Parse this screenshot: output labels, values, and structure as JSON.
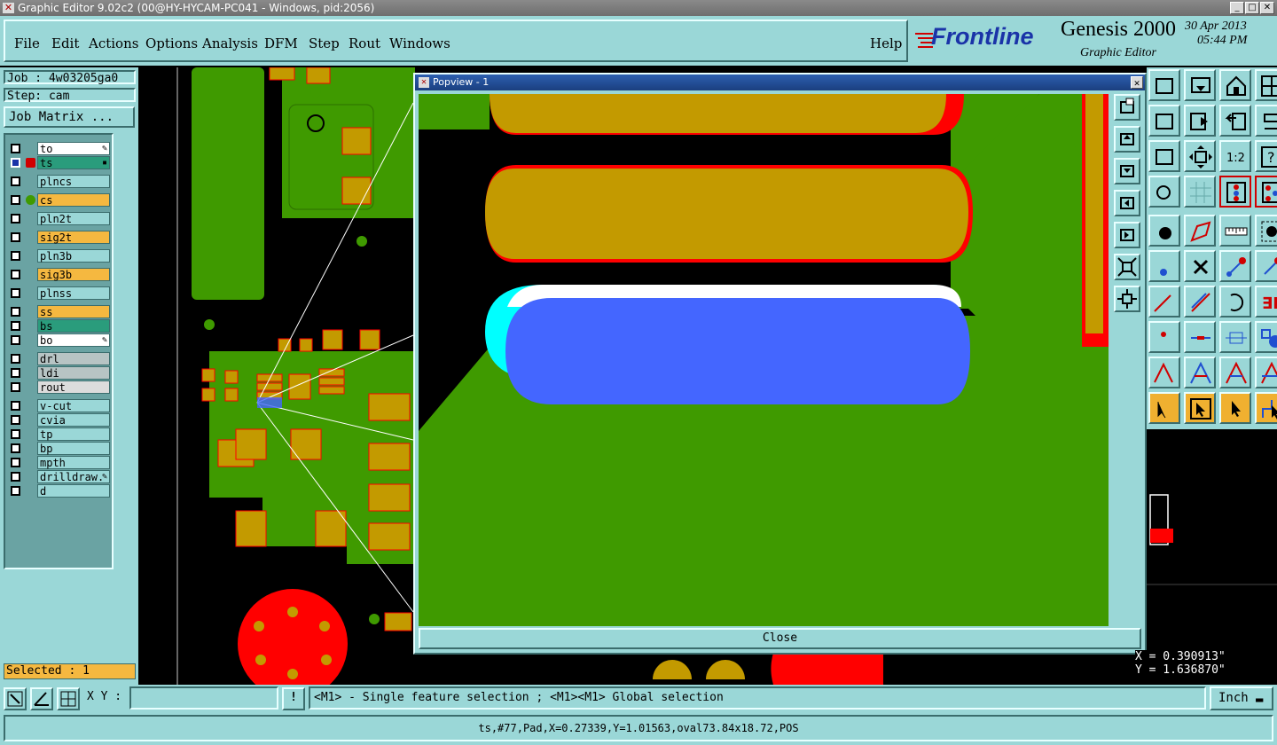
{
  "window": {
    "title": "Graphic Editor 9.02c2 (00@HY-HYCAM-PC041 - Windows, pid:2056)",
    "controls": [
      "_",
      "□",
      "✕"
    ]
  },
  "menu": {
    "items": [
      "File",
      "Edit",
      "Actions",
      "Options",
      "Analysis",
      "DFM",
      "Step",
      "Rout",
      "Windows"
    ],
    "help": "Help"
  },
  "logo": {
    "brand": "Frontline",
    "product": "Genesis 2000",
    "subtitle": "Graphic Editor",
    "date": "30 Apr 2013",
    "time": "05:44 PM"
  },
  "job": {
    "job_label": "Job : 4w03205ga0",
    "step_label": "Step: cam",
    "matrix_button": "Job Matrix ..."
  },
  "layers": [
    {
      "name": "to",
      "bg": "#ffffff",
      "mark": "pen"
    },
    {
      "name": "ts",
      "bg": "#2a9c7c",
      "mark": "active"
    },
    {
      "name": "plncs",
      "bg": "#9ad7d7"
    },
    {
      "name": "cs",
      "bg": "#f5b840",
      "mark": "green-dot"
    },
    {
      "name": "pln2t",
      "bg": "#9ad7d7"
    },
    {
      "name": "sig2t",
      "bg": "#f5b840"
    },
    {
      "name": "pln3b",
      "bg": "#9ad7d7"
    },
    {
      "name": "sig3b",
      "bg": "#f5b840"
    },
    {
      "name": "plnss",
      "bg": "#9ad7d7"
    },
    {
      "name": "ss",
      "bg": "#f5b840"
    },
    {
      "name": "bs",
      "bg": "#2a9c7c"
    },
    {
      "name": "bo",
      "bg": "#ffffff",
      "mark": "pen"
    },
    {
      "name": "drl",
      "bg": "#b7c4c4"
    },
    {
      "name": "ldi",
      "bg": "#b7c4c4"
    },
    {
      "name": "rout",
      "bg": "#dcdcdc"
    },
    {
      "name": "v-cut",
      "bg": "#9ad7d7"
    },
    {
      "name": "cvia",
      "bg": "#9ad7d7"
    },
    {
      "name": "tp",
      "bg": "#9ad7d7"
    },
    {
      "name": "bp",
      "bg": "#9ad7d7"
    },
    {
      "name": "mpth",
      "bg": "#9ad7d7"
    },
    {
      "name": "drilldraw.",
      "bg": "#9ad7d7",
      "mark": "pen"
    },
    {
      "name": "d",
      "bg": "#9ad7d7"
    }
  ],
  "selected": "Selected : 1",
  "popview": {
    "title": "Popview - 1",
    "close_label": "Close"
  },
  "coords": {
    "x": "X = 0.390913\"",
    "y": "Y = 1.636870\""
  },
  "bottom": {
    "xy_label": "X Y :",
    "xy_value": "",
    "hint": "<M1> - Single feature selection ; <M1><M1> Global selection",
    "units": "Inch"
  },
  "status": "ts,#77,Pad,X=0.27339,Y=1.01563,oval73.84x18.72,POS",
  "colors": {
    "panel": "#9ad7d7",
    "copper_green": "#3f9a00",
    "pad_gold": "#c39a00",
    "pad_red": "#ff0000",
    "selection_blue": "#4466ff"
  }
}
